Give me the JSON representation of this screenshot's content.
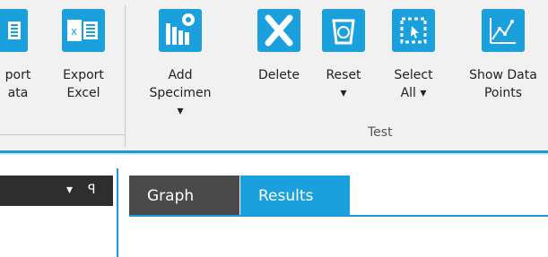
{
  "ribbon": {
    "buttons": [
      {
        "id": "export-data",
        "label": "port\nata"
      },
      {
        "id": "export-excel",
        "label": "Export\nExcel"
      },
      {
        "id": "add-specimen",
        "label": "Add\nSpecimen ▾"
      },
      {
        "id": "delete",
        "label": "Delete"
      },
      {
        "id": "reset",
        "label": "Reset\n▾"
      },
      {
        "id": "select-all",
        "label": "Select\nAll ▾"
      },
      {
        "id": "show-data-points",
        "label": "Show Data\nPoints"
      }
    ],
    "group_label": "Test"
  },
  "panel": {
    "dropdown_symbol": "▾",
    "pin_symbol": "ꟼ"
  },
  "tabs": [
    {
      "label": "Graph"
    },
    {
      "label": "Results"
    }
  ],
  "colors": {
    "accent": "#1aa0dd",
    "dark_panel": "#2e2e2e",
    "inactive_tab": "#4a4a4a"
  }
}
